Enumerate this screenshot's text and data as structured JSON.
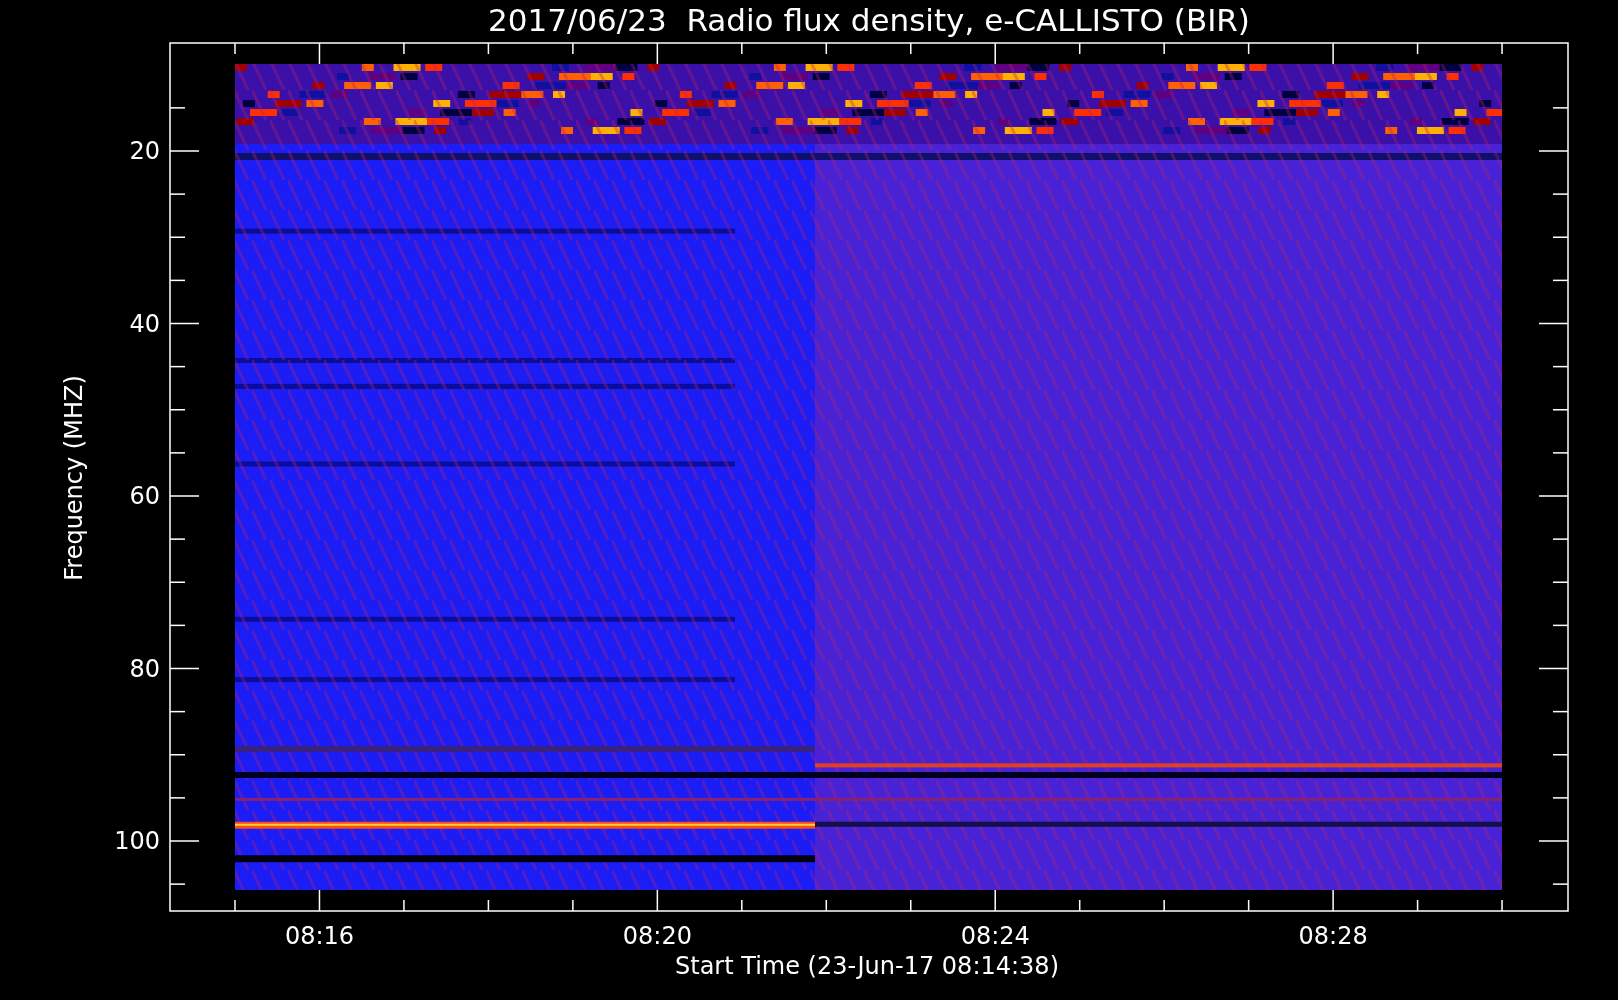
{
  "title": "2017/06/23  Radio flux density, e-CALLISTO (BIR)",
  "y_axis": {
    "label": "Frequency (MHZ)",
    "ticks": [
      "20",
      "40",
      "60",
      "80",
      "100"
    ]
  },
  "x_axis": {
    "label": "Start Time (23-Jun-17 08:14:38)",
    "ticks": [
      "08:16",
      "08:20",
      "08:24",
      "08:28"
    ]
  }
}
